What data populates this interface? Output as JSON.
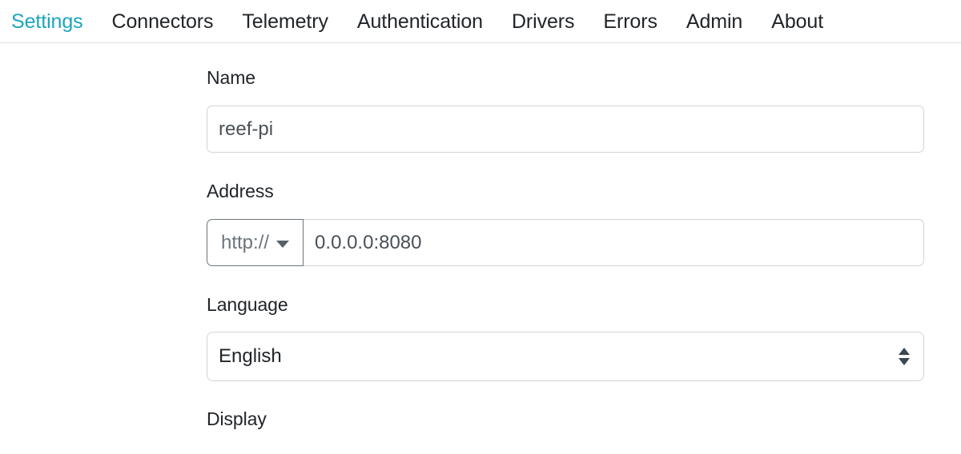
{
  "navbar": {
    "items": [
      {
        "label": "Settings",
        "active": true
      },
      {
        "label": "Connectors",
        "active": false
      },
      {
        "label": "Telemetry",
        "active": false
      },
      {
        "label": "Authentication",
        "active": false
      },
      {
        "label": "Drivers",
        "active": false
      },
      {
        "label": "Errors",
        "active": false
      },
      {
        "label": "Admin",
        "active": false
      },
      {
        "label": "About",
        "active": false
      }
    ],
    "active_color": "#1ca5bd",
    "text_color": "#212529"
  },
  "form": {
    "name": {
      "label": "Name",
      "value": "reef-pi",
      "placeholder": ""
    },
    "address": {
      "label": "Address",
      "scheme": "http://",
      "value": "0.0.0.0:8080",
      "placeholder": ""
    },
    "language": {
      "label": "Language",
      "value": "English",
      "options": [
        "English"
      ]
    },
    "display": {
      "label": "Display"
    }
  }
}
